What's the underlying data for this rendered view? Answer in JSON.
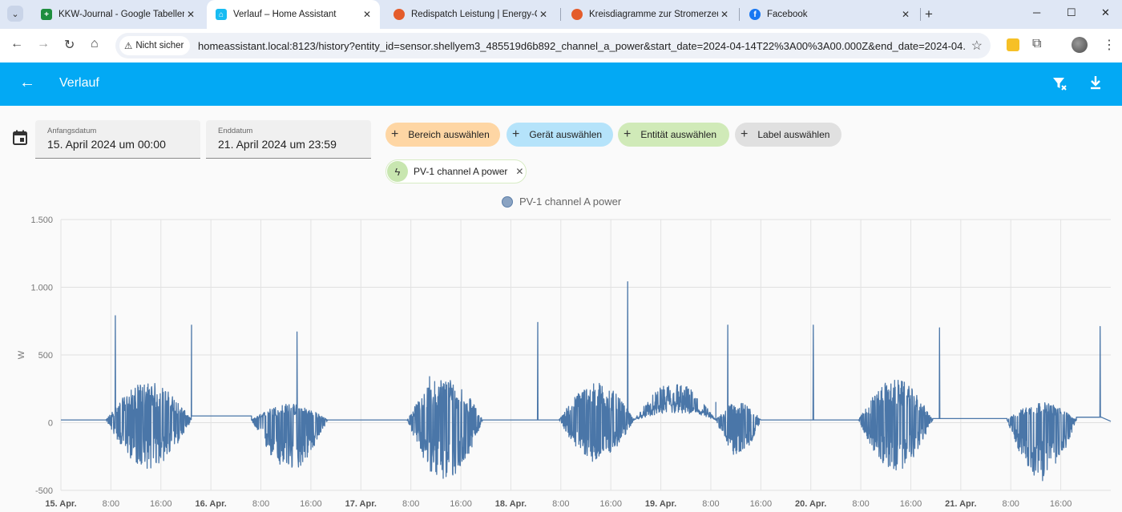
{
  "browser": {
    "tabs": [
      {
        "title": "KKW-Journal - Google Tabellen",
        "favicon": "sheets-icon",
        "color": "#1e8e3e"
      },
      {
        "title": "Verlauf – Home Assistant",
        "favicon": "home-assistant-icon",
        "color": "#18bcf2"
      },
      {
        "title": "Redispatch Leistung | Energy-Charts",
        "favicon": "energy-charts-icon",
        "color": "#e45c2b"
      },
      {
        "title": "Kreisdiagramme zur Stromerzeugung",
        "favicon": "energy-charts-icon",
        "color": "#e45c2b"
      },
      {
        "title": "Facebook",
        "favicon": "facebook-icon",
        "color": "#1877f2"
      }
    ],
    "security_label": "Nicht sicher",
    "url": "homeassistant.local:8123/history?entity_id=sensor.shellyem3_485519d6b892_channel_a_power&start_date=2024-04-14T22%3A00%3A00.000Z&end_date=2024-04..."
  },
  "header": {
    "title": "Verlauf"
  },
  "controls": {
    "start_label": "Anfangsdatum",
    "start_value": "15. April 2024 um 00:00",
    "end_label": "Enddatum",
    "end_value": "21. April 2024 um 23:59",
    "chips": {
      "area": "Bereich auswählen",
      "device": "Gerät auswählen",
      "entity": "Entität auswählen",
      "label": "Label auswählen"
    },
    "selected_entity": "PV-1 channel A power"
  },
  "chart_data": {
    "type": "line",
    "title": "",
    "series": [
      {
        "name": "PV-1 channel A power",
        "color": "#4a76a8"
      }
    ],
    "ylabel": "W",
    "ylim": [
      -500,
      1500
    ],
    "yticks": [
      -500,
      0,
      500,
      1000,
      1500
    ],
    "ytick_labels": [
      "-500",
      "0",
      "500",
      "1.000",
      "1.500"
    ],
    "xlim_hours": [
      0,
      168
    ],
    "xticks": [
      {
        "h": 0,
        "label": "15. Apr.",
        "major": true
      },
      {
        "h": 8,
        "label": "8:00"
      },
      {
        "h": 16,
        "label": "16:00"
      },
      {
        "h": 24,
        "label": "16. Apr.",
        "major": true
      },
      {
        "h": 32,
        "label": "8:00"
      },
      {
        "h": 40,
        "label": "16:00"
      },
      {
        "h": 48,
        "label": "17. Apr.",
        "major": true
      },
      {
        "h": 56,
        "label": "8:00"
      },
      {
        "h": 64,
        "label": "16:00"
      },
      {
        "h": 72,
        "label": "18. Apr.",
        "major": true
      },
      {
        "h": 80,
        "label": "8:00"
      },
      {
        "h": 88,
        "label": "16:00"
      },
      {
        "h": 96,
        "label": "19. Apr.",
        "major": true
      },
      {
        "h": 104,
        "label": "8:00"
      },
      {
        "h": 112,
        "label": "16:00"
      },
      {
        "h": 120,
        "label": "20. Apr.",
        "major": true
      },
      {
        "h": 128,
        "label": "8:00"
      },
      {
        "h": 136,
        "label": "16:00"
      },
      {
        "h": 144,
        "label": "21. Apr.",
        "major": true
      },
      {
        "h": 152,
        "label": "8:00"
      },
      {
        "h": 160,
        "label": "16:00"
      }
    ],
    "baseline_w": 20,
    "days": [
      {
        "start_h": 7.2,
        "end_h": 20.9,
        "low": -340,
        "high": 300,
        "after_level": 50,
        "spikes": [
          [
            8.7,
            790
          ],
          [
            20.9,
            720
          ]
        ]
      },
      {
        "start_h": 30.5,
        "end_h": 42.7,
        "low": -360,
        "high": 140,
        "after_level": 20,
        "spikes": [
          [
            37.8,
            670
          ]
        ]
      },
      {
        "start_h": 55.4,
        "end_h": 67.5,
        "low": -440,
        "high": 340,
        "after_level": 20,
        "spikes": [
          [
            59.0,
            340
          ]
        ]
      },
      {
        "start_h": 79.7,
        "end_h": 91.7,
        "low": -290,
        "high": 300,
        "after_level": 30,
        "spikes": [
          [
            76.3,
            740
          ],
          [
            90.7,
            1040
          ]
        ]
      },
      {
        "start_h": 91.7,
        "end_h": 104.8,
        "low": 150,
        "high": 300,
        "after_level": 150,
        "spikes": []
      },
      {
        "start_h": 104.8,
        "end_h": 112.0,
        "low": -250,
        "high": 150,
        "after_level": 20,
        "spikes": [
          [
            106.7,
            720
          ]
        ]
      },
      {
        "start_h": 127.6,
        "end_h": 139.5,
        "low": -360,
        "high": 320,
        "after_level": 30,
        "spikes": [
          [
            120.4,
            720
          ],
          [
            140.6,
            700
          ]
        ]
      },
      {
        "start_h": 151.4,
        "end_h": 162.5,
        "low": -430,
        "high": 150,
        "after_level": 40,
        "spikes": [
          [
            166.3,
            710
          ]
        ]
      }
    ]
  }
}
